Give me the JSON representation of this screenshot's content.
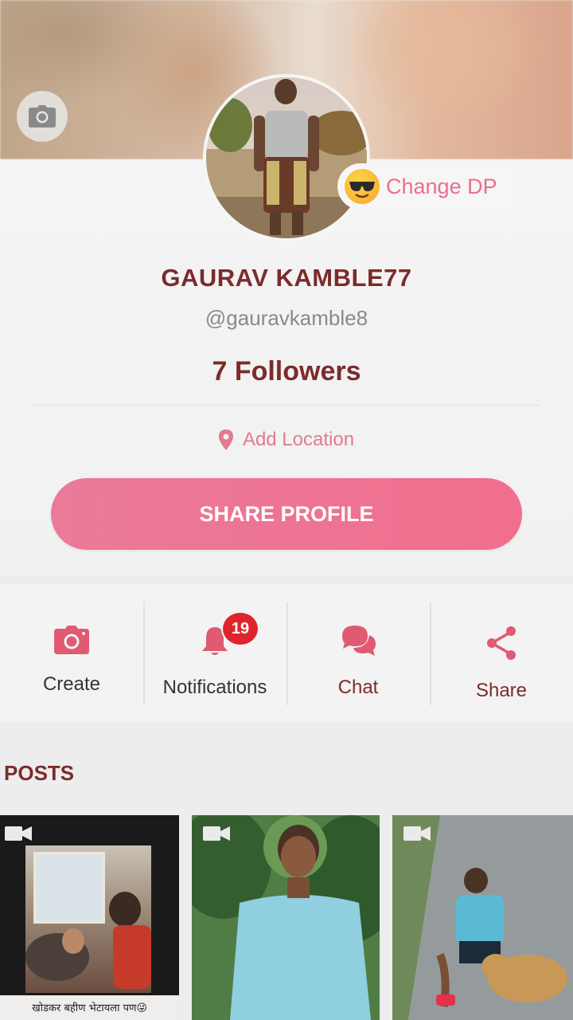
{
  "profile": {
    "change_dp_label": "Change DP",
    "name": "GAURAV KAMBLE77",
    "handle": "@gauravkamble8",
    "followers": "7 Followers",
    "location_label": "Add Location",
    "share_profile_label": "SHARE PROFILE"
  },
  "actions": [
    {
      "label": "Create",
      "icon": "camera-icon"
    },
    {
      "label": "Notifications",
      "icon": "bell-icon",
      "badge": "19"
    },
    {
      "label": "Chat",
      "icon": "chat-bubbles-icon"
    },
    {
      "label": "Share",
      "icon": "share-icon"
    }
  ],
  "posts": {
    "title": "POSTS",
    "items": [
      {
        "type": "video",
        "caption": "खोडकर बहीण भेटायला पण😜"
      },
      {
        "type": "video"
      },
      {
        "type": "video"
      }
    ]
  },
  "colors": {
    "accent": "#f16e8e",
    "name_color": "#7c2b2b",
    "badge": "#e0242c"
  }
}
